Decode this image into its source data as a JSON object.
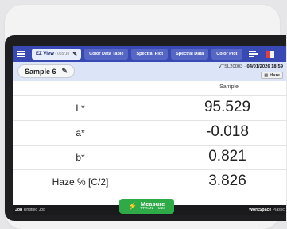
{
  "tabs": [
    {
      "label": "EZ View",
      "sub": "· 065/10",
      "active": true
    },
    {
      "label": "Color Data Table"
    },
    {
      "label": "Spectral Plot"
    },
    {
      "label": "Spectral Data"
    },
    {
      "label": "Color Plot"
    }
  ],
  "sample": {
    "name": "Sample 6"
  },
  "instrument": {
    "id": "VTSL20003",
    "separator": " · ",
    "datetime": "04/01/2026 18:59",
    "mode_chip": "Haze"
  },
  "table": {
    "column_header": "Sample",
    "rows": [
      {
        "label": "L*",
        "value": "95.529"
      },
      {
        "label": "a*",
        "value": "-0.018"
      },
      {
        "label": "b*",
        "value": "0.821"
      },
      {
        "label": "Haze % [C/2]",
        "value": "3.826"
      }
    ]
  },
  "footer": {
    "job_label": "Job",
    "job_value": "Untitled Job",
    "workspace_label": "WorkSpace",
    "workspace_value": "Plastic"
  },
  "measure": {
    "label": "Measure",
    "sub": "TTRAN - Haze"
  },
  "colors": {
    "tabbar": "#3949b3",
    "header_bg": "#dce4f7",
    "measure": "#2eaa48"
  }
}
